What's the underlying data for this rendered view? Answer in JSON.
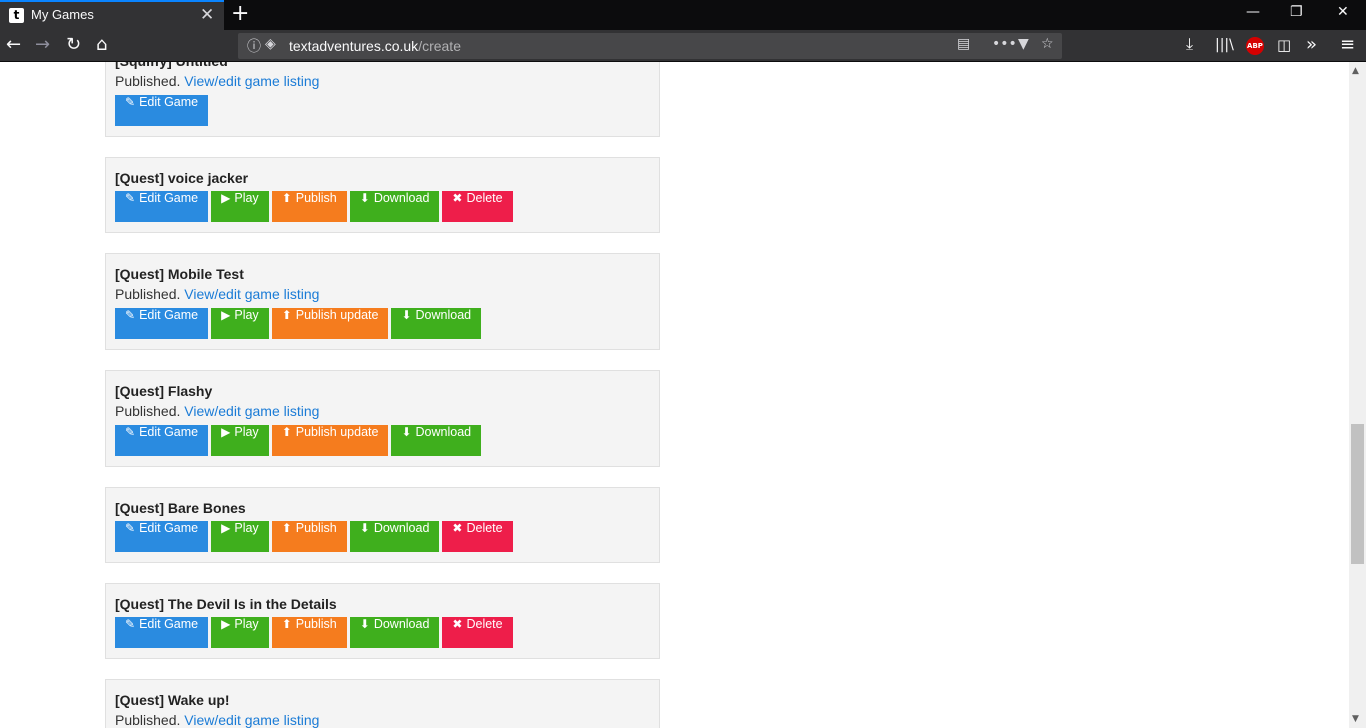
{
  "browser": {
    "tab_favicon": "t",
    "tab_title": "My Games",
    "tab_close": "✕",
    "new_tab": "+",
    "url_domain": "textadventures.co.uk",
    "url_path": "/create",
    "abp_label": "ABP"
  },
  "games": [
    {
      "title": "[Squiffy] Untitled",
      "status": "Published.",
      "link": "View/edit game listing",
      "buttons": [
        {
          "kind": "edit",
          "label": "Edit Game",
          "icon": "pencil-icon"
        }
      ]
    },
    {
      "title": "[Quest] voice jacker",
      "status": "",
      "link": "",
      "buttons": [
        {
          "kind": "edit",
          "label": "Edit Game",
          "icon": "pencil-icon"
        },
        {
          "kind": "play",
          "label": "Play",
          "icon": "play-icon"
        },
        {
          "kind": "publish",
          "label": "Publish",
          "icon": "upload-circle-icon"
        },
        {
          "kind": "download",
          "label": "Download",
          "icon": "download-icon"
        },
        {
          "kind": "delete",
          "label": "Delete",
          "icon": "x-icon"
        }
      ]
    },
    {
      "title": "[Quest] Mobile Test",
      "status": "Published.",
      "link": "View/edit game listing",
      "buttons": [
        {
          "kind": "edit",
          "label": "Edit Game",
          "icon": "pencil-icon"
        },
        {
          "kind": "play",
          "label": "Play",
          "icon": "play-icon"
        },
        {
          "kind": "publish",
          "label": "Publish update",
          "icon": "upload-circle-icon"
        },
        {
          "kind": "download",
          "label": "Download",
          "icon": "download-icon"
        }
      ]
    },
    {
      "title": "[Quest] Flashy",
      "status": "Published.",
      "link": "View/edit game listing",
      "buttons": [
        {
          "kind": "edit",
          "label": "Edit Game",
          "icon": "pencil-icon"
        },
        {
          "kind": "play",
          "label": "Play",
          "icon": "play-icon"
        },
        {
          "kind": "publish",
          "label": "Publish update",
          "icon": "upload-circle-icon"
        },
        {
          "kind": "download",
          "label": "Download",
          "icon": "download-icon"
        }
      ]
    },
    {
      "title": "[Quest] Bare Bones",
      "status": "",
      "link": "",
      "buttons": [
        {
          "kind": "edit",
          "label": "Edit Game",
          "icon": "pencil-icon"
        },
        {
          "kind": "play",
          "label": "Play",
          "icon": "play-icon"
        },
        {
          "kind": "publish",
          "label": "Publish",
          "icon": "upload-circle-icon"
        },
        {
          "kind": "download",
          "label": "Download",
          "icon": "download-icon"
        },
        {
          "kind": "delete",
          "label": "Delete",
          "icon": "x-icon"
        }
      ]
    },
    {
      "title": "[Quest] The Devil Is in the Details",
      "status": "",
      "link": "",
      "buttons": [
        {
          "kind": "edit",
          "label": "Edit Game",
          "icon": "pencil-icon"
        },
        {
          "kind": "play",
          "label": "Play",
          "icon": "play-icon"
        },
        {
          "kind": "publish",
          "label": "Publish",
          "icon": "upload-circle-icon"
        },
        {
          "kind": "download",
          "label": "Download",
          "icon": "download-icon"
        },
        {
          "kind": "delete",
          "label": "Delete",
          "icon": "x-icon"
        }
      ]
    },
    {
      "title": "[Quest] Wake up!",
      "status": "Published.",
      "link": "View/edit game listing",
      "buttons": []
    }
  ],
  "colors": {
    "edit": "#2a8be0",
    "play": "#3faf1d",
    "publish": "#f57c1e",
    "download": "#3faf1d",
    "delete": "#ee1e4a",
    "link": "#1a7bd6"
  }
}
